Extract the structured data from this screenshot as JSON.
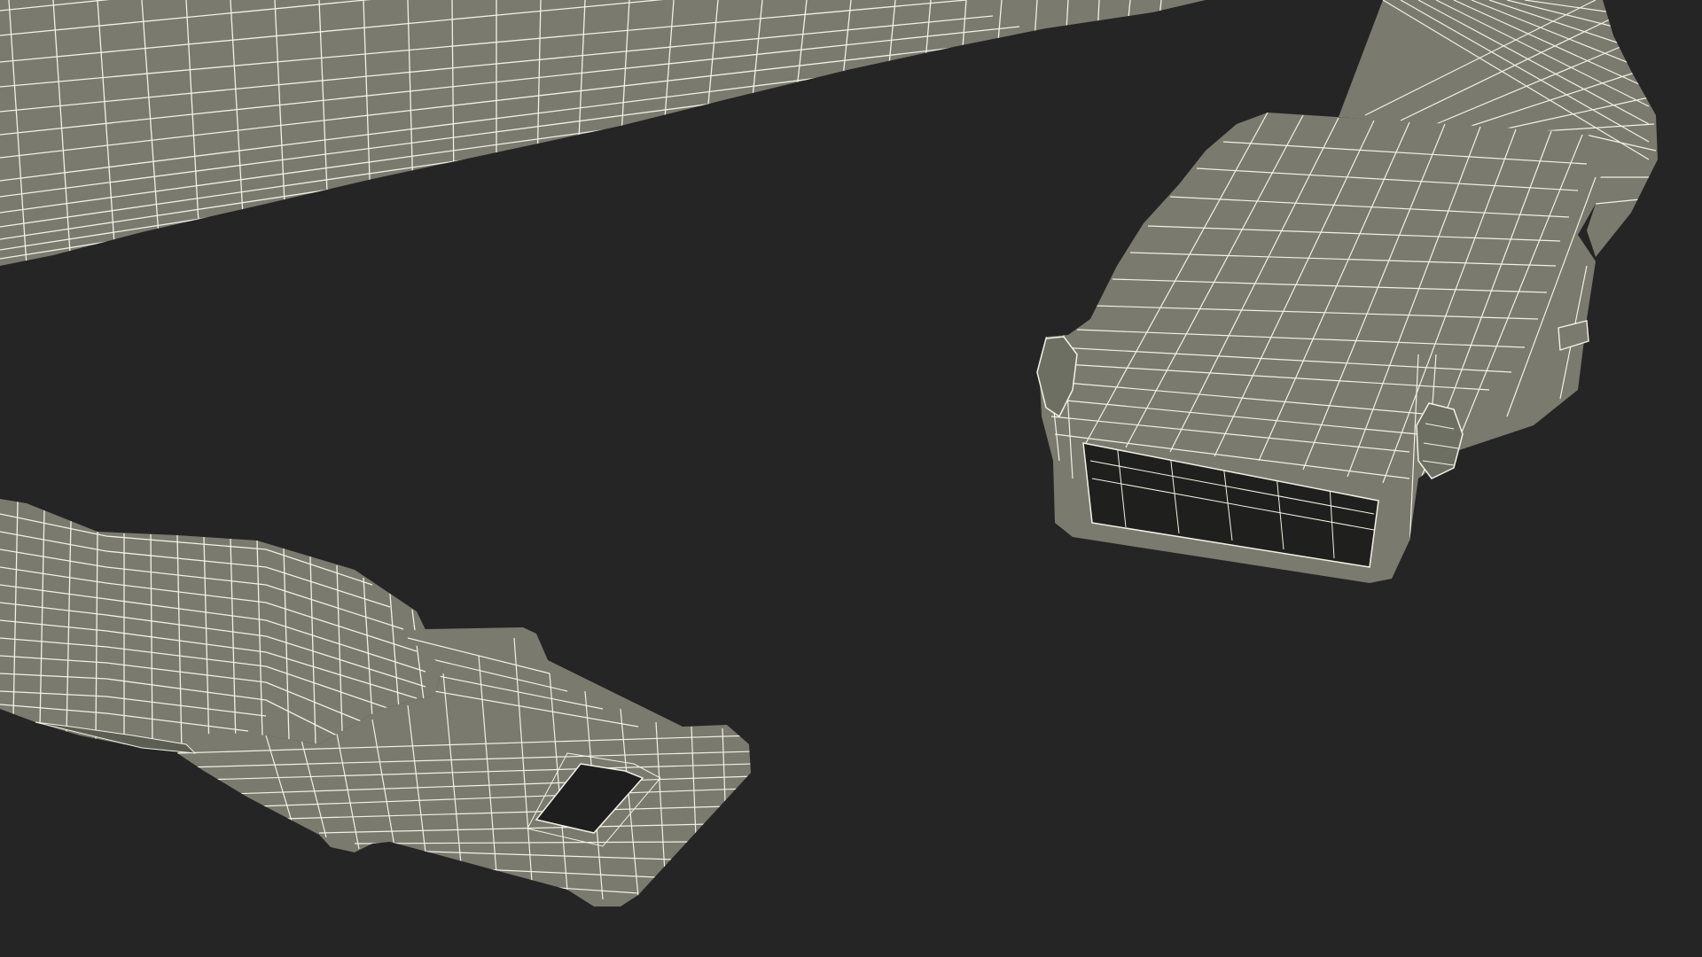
{
  "scene": {
    "background_color": "#252525",
    "surface_color": "#7a7b6e",
    "surface_shadow_color": "#5c5d53",
    "wire_color": "#f1f1e6",
    "objects": [
      "seat-belt-strap",
      "seat-belt-tongue",
      "seat-belt-buckle"
    ]
  }
}
